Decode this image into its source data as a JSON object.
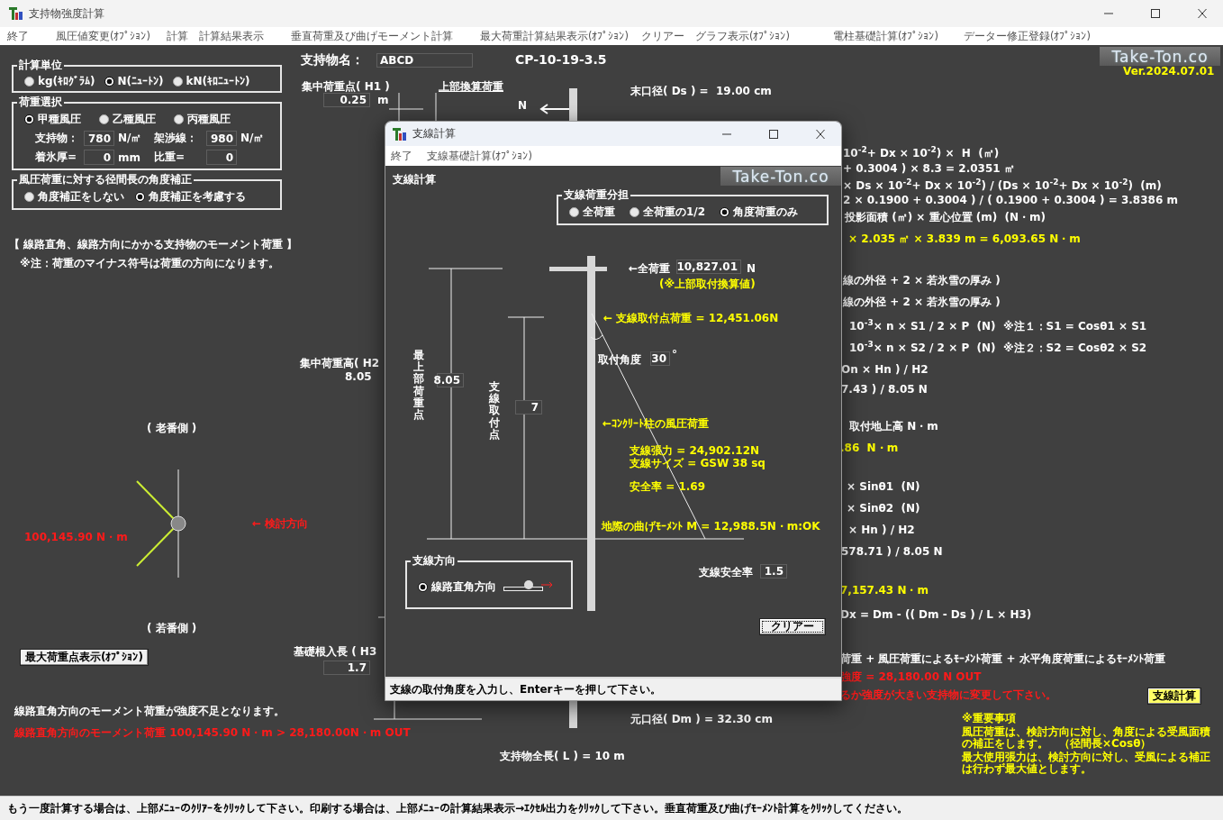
{
  "window": {
    "title": "支持物強度計算"
  },
  "menu": [
    {
      "label": "終了"
    },
    {
      "label": "風圧値変更(ｵﾌﾟｼｮﾝ)"
    },
    {
      "label": "計算"
    },
    {
      "label": "計算結果表示"
    },
    {
      "label": "垂直荷重及び曲げモーメント計算"
    },
    {
      "label": "最大荷重計算結果表示(ｵﾌﾟｼｮﾝ)"
    },
    {
      "label": "クリアー"
    },
    {
      "label": "グラフ表示(ｵﾌﾟｼｮﾝ)"
    },
    {
      "label": "電柱基礎計算(ｵﾌﾟｼｮﾝ)"
    },
    {
      "label": "データー修正登録(ｵﾌﾟｼｮﾝ)"
    }
  ],
  "unit_group": {
    "title": "計算単位",
    "options": [
      {
        "label": "kg(ｷﾛｸﾞﾗﾑ)",
        "selected": false
      },
      {
        "label": "N(ﾆｭｰﾄﾝ)",
        "selected": true
      },
      {
        "label": "kN(ｷﾛﾆｭｰﾄﾝ)",
        "selected": false
      }
    ]
  },
  "load_group": {
    "title": "荷重選択",
    "options": [
      {
        "label": "甲種風圧",
        "selected": true
      },
      {
        "label": "乙種風圧",
        "selected": false
      },
      {
        "label": "丙種風圧",
        "selected": false
      }
    ],
    "fields": [
      {
        "label": "支持物：",
        "value": "780",
        "unit": "N/㎡"
      },
      {
        "label": "架渉線：",
        "value": "980",
        "unit": "N/㎡"
      },
      {
        "label": "着氷厚=",
        "value": "0",
        "unit": "mm"
      },
      {
        "label": "比重=",
        "value": "0"
      }
    ]
  },
  "angle_group": {
    "title": "風圧荷重に対する径間長の角度補正",
    "options": [
      {
        "label": "角度補正をしない",
        "selected": false
      },
      {
        "label": "角度補正を考慮する",
        "selected": true
      }
    ]
  },
  "support_name": {
    "label": "支持物名：",
    "value": "ABCD"
  },
  "model": "CP-10-19-3.5",
  "logo": "Take-Ton.co",
  "version": "Ver.2024.07.01",
  "canvas_texts": [
    {
      "text": "集中荷重点( H1 )",
      "kind": "white"
    },
    {
      "text": "上部換算荷重",
      "kind": "underlined"
    },
    {
      "text": "m",
      "kind": "white"
    },
    {
      "text": "N",
      "kind": "white"
    },
    {
      "text": "末口径( Ds ) =  19.00 cm",
      "kind": "white"
    },
    {
      "text": "【 線路直角、線路方向にかかる支持物のモーメント荷重 】",
      "kind": "white"
    },
    {
      "text": "※注：荷重のマイナス符号は荷重の方向になります。",
      "kind": "white"
    },
    {
      "text": "集中荷重高( H2",
      "kind": "white"
    },
    {
      "text": "8.05",
      "kind": "white"
    },
    {
      "text": "( 老番側 )",
      "kind": "white"
    },
    {
      "text": "100,145.90 N・m",
      "kind": "red"
    },
    {
      "text": "← 検討方向",
      "kind": "red"
    },
    {
      "text": "( 若番側 )",
      "kind": "white"
    },
    {
      "text": "基礎根入長 ( H3",
      "kind": "white"
    },
    {
      "text": "線路直角方向のモーメント荷重が強度不足となります。",
      "kind": "white"
    },
    {
      "text": "線路直角方向のモーメント荷重 100,145.90 N・m > 28,180.00N・m OUT",
      "kind": "red"
    },
    {
      "text": "元口径( Dm ) = 32.30 cm",
      "kind": "white"
    },
    {
      "text": "支持物全長( L ) = 10 m",
      "kind": "white"
    },
    {
      "text": "10$^{-2}$+ Dx × 10$^{-2}$) ×  H  (㎡)",
      "kind": "white"
    },
    {
      "text": "+ 0.3004 ) × 8.3 = 2.0351 ㎡",
      "kind": "white"
    },
    {
      "text": "× Ds × 10$^{-2}$+ Dx × 10$^{-2}$) / (Ds × 10$^{-2}$+ Dx × 10$^{-2}$)  (m)",
      "kind": "white"
    },
    {
      "text": "2 × 0.1900 + 0.3004 ) / ( 0.1900 + 0.3004 ) = 3.8386 m",
      "kind": "white"
    },
    {
      "text": "投影面積 (㎡) × 重心位置 (m)  (N・m)",
      "kind": "white"
    },
    {
      "text": "× 2.035 ㎡ × 3.839 m = 6,093.65 N・m",
      "kind": "yellow"
    },
    {
      "text": "線の外径 + 2 × 若氷雪の厚み )",
      "kind": "white"
    },
    {
      "text": "線の外径 + 2 × 若氷雪の厚み )",
      "kind": "white"
    },
    {
      "text": "10$^{-3}$× n × S1 / 2 × P  (N)  ※注１：S1 = Cosθ1 × S1",
      "kind": "white"
    },
    {
      "text": "10$^{-3}$× n × S2 / 2 × P  (N)  ※注２：S2 = Cosθ2 × S2",
      "kind": "white"
    },
    {
      "text": "On × Hn ) / H2",
      "kind": "white"
    },
    {
      "text": "7.43 ) / 8.05 N",
      "kind": "white"
    },
    {
      "text": "取付地上高 N・m",
      "kind": "white"
    },
    {
      "text": ".86  N・m",
      "kind": "yellow"
    },
    {
      "text": "× Sinθ1  (N)",
      "kind": "white"
    },
    {
      "text": "× Sinθ2  (N)",
      "kind": "white"
    },
    {
      "text": "× Hn ) / H2",
      "kind": "white"
    },
    {
      "text": "578.71 ) / 8.05 N",
      "kind": "white"
    },
    {
      "text": "7,157.43 N・m",
      "kind": "yellow"
    },
    {
      "text": "Dx = Dm - (( Dm - Ds ) / L × H3)",
      "kind": "white"
    },
    {
      "text": "荷重 + 風圧荷重によるﾓｰﾒﾝﾄ荷重 + 水平角度荷重によるﾓｰﾒﾝﾄ荷重",
      "kind": "white"
    },
    {
      "text": "強度 = 28,180.00 N OUT",
      "kind": "red"
    },
    {
      "text": "るか強度が大きい支持物に変更して下さい。",
      "kind": "red"
    }
  ],
  "canvas_fields": [
    {
      "value": "0.25"
    },
    {
      "value": "1.7"
    }
  ],
  "max_point_button": "最大荷重点表示(ｵﾌﾟｼｮﾝ)",
  "guy_button": "支線計算",
  "notes": [
    "※重要事項",
    "風圧荷重は、検討方向に対し、角度による受風面積の補正をします。　（径間長×Cosθ）",
    "最大使用張力は、検討方向に対し、受風による補正は行わず最大値とします。"
  ],
  "status_bar": "もう一度計算する場合は、上部ﾒﾆｭｰのｸﾘｱｰをｸﾘｯｸして下さい。印刷する場合は、上部ﾒﾆｭｰの計算結果表示→ｴｸｾﾙ出力をｸﾘｯｸして下さい。垂直荷重及び曲げﾓｰﾒﾝﾄ計算をｸﾘｯｸしてください。",
  "dialog": {
    "title": "支線計算",
    "menu": [
      {
        "label": "終了"
      },
      {
        "label": "支線基礎計算(ｵﾌﾟｼｮﾝ)"
      }
    ],
    "heading": "支線計算",
    "logo": "Take-Ton.co",
    "share_group": {
      "title": "支線荷重分担",
      "options": [
        {
          "label": "全荷重",
          "selected": false
        },
        {
          "label": "全荷重の1/2",
          "selected": false
        },
        {
          "label": "角度荷重のみ",
          "selected": true
        }
      ]
    },
    "vertical_labels": [
      "最上部荷重点",
      "支線取付点"
    ],
    "height_fields": [
      {
        "value": "8.05"
      },
      {
        "value": "7"
      }
    ],
    "total_load": {
      "label": "←全荷重",
      "value": "10,827.01",
      "unit": "N",
      "note": "(※上部取付換算値)"
    },
    "texts": [
      {
        "text": "← 支線取付点荷重 = 12,451.06N",
        "kind": "yellow"
      },
      {
        "text": "←ｺﾝｸﾘｰﾄ柱の風圧荷重",
        "kind": "yellow"
      },
      {
        "text": "支線張力 = 24,902.12N",
        "kind": "yellow"
      },
      {
        "text": "支線サイズ = GSW 38 sq",
        "kind": "yellow"
      },
      {
        "text": "安全率 = 1.69",
        "kind": "yellow"
      },
      {
        "text": "地際の曲げﾓｰﾒﾝﾄ M = 12,988.5N・m:OK",
        "kind": "yellow"
      }
    ],
    "angle": {
      "label": "取付角度",
      "value": "30",
      "unit": "°"
    },
    "direction_group": {
      "title": "支線方向",
      "options": [
        {
          "label": "線路直角方向",
          "selected": true
        }
      ]
    },
    "safety": {
      "label": "支線安全率",
      "value": "1.5"
    },
    "clear_button": "クリアー",
    "status_bar": "支線の取付角度を入力し、Enterキーを押して下さい。"
  }
}
